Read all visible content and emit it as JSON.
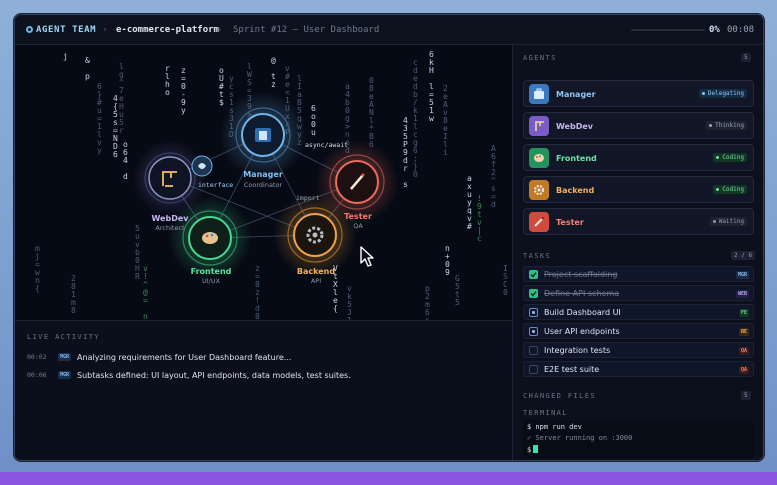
{
  "app": {
    "brand": "AGENT TEAM",
    "project": "e-commerce-platform",
    "sprint": "Sprint #12 — User Dashboard",
    "progress_pct": "0%",
    "progress_value": 0,
    "timer": "00:08"
  },
  "network": {
    "nodes": [
      {
        "name": "Manager",
        "role": "Coordinator",
        "color": "#7fc0f0"
      },
      {
        "name": "WebDev",
        "role": "Architect",
        "color": "#c9b7f5"
      },
      {
        "name": "Frontend",
        "role": "UI/UX",
        "color": "#5fe39b"
      },
      {
        "name": "Backend",
        "role": "API",
        "color": "#f3b061"
      },
      {
        "name": "Tester",
        "role": "QA",
        "color": "#f07a6e"
      }
    ],
    "edge_labels": [
      "async/await",
      "interface",
      "import"
    ]
  },
  "activity": {
    "title": "LIVE ACTIVITY",
    "rows": [
      {
        "time": "00:02",
        "badge": "MGR",
        "text": "Analyzing requirements for User Dashboard feature..."
      },
      {
        "time": "00:06",
        "badge": "MGR",
        "text": "Subtasks defined: UI layout, API endpoints, data models, test suites."
      }
    ]
  },
  "agents": {
    "title": "AGENTS",
    "count": "5",
    "items": [
      {
        "name": "Manager",
        "status": "Delegating",
        "icon": "briefcase-icon",
        "color": "#8cc6f5",
        "bg": "#3a78c0",
        "status_color": "#8cc6f5",
        "status_bg": "#142b45"
      },
      {
        "name": "WebDev",
        "status": "Thinking",
        "icon": "crane-icon",
        "color": "#c8b6f5",
        "bg": "#7a5cc9",
        "status_color": "#9aa3b6",
        "status_bg": "#1c2232"
      },
      {
        "name": "Frontend",
        "status": "Coding",
        "icon": "palette-icon",
        "color": "#6fe3a3",
        "bg": "#24925c",
        "status_color": "#6fe3a3",
        "status_bg": "#123524"
      },
      {
        "name": "Backend",
        "status": "Coding",
        "icon": "gear-icon",
        "color": "#f3b061",
        "bg": "#c07a25",
        "status_color": "#6fe3a3",
        "status_bg": "#123524"
      },
      {
        "name": "Tester",
        "status": "Waiting",
        "icon": "pen-icon",
        "color": "#f28275",
        "bg": "#d24a3e",
        "status_color": "#8f98ab",
        "status_bg": "#1c2232"
      }
    ]
  },
  "tasks": {
    "title": "TASKS",
    "count": "2 / 6",
    "items": [
      {
        "label": "Project scaffolding",
        "tag": "MGR",
        "done": true,
        "tag_color": "#8cb8e6",
        "tag_bg": "#1a2c45"
      },
      {
        "label": "Define API schema",
        "tag": "WEB",
        "done": true,
        "tag_color": "#b9a7ee",
        "tag_bg": "#261f45"
      },
      {
        "label": "Build Dashboard UI",
        "tag": "FE",
        "done": false,
        "active": true,
        "tag_color": "#6fe3a3",
        "tag_bg": "#123524"
      },
      {
        "label": "User API endpoints",
        "tag": "BE",
        "done": false,
        "active": true,
        "tag_color": "#f3b061",
        "tag_bg": "#3a2812"
      },
      {
        "label": "Integration tests",
        "tag": "QA",
        "done": false,
        "tag_color": "#f28275",
        "tag_bg": "#3c1b1b"
      },
      {
        "label": "E2E test suite",
        "tag": "QA",
        "done": false,
        "tag_color": "#f28275",
        "tag_bg": "#3c1b1b"
      }
    ]
  },
  "changed_files": {
    "title": "CHANGED FILES",
    "count": "5"
  },
  "terminal": {
    "title": "TERMINAL",
    "cmd": "$ npm run dev",
    "out": "✓ Server running on :3000",
    "prompt": "$"
  }
}
